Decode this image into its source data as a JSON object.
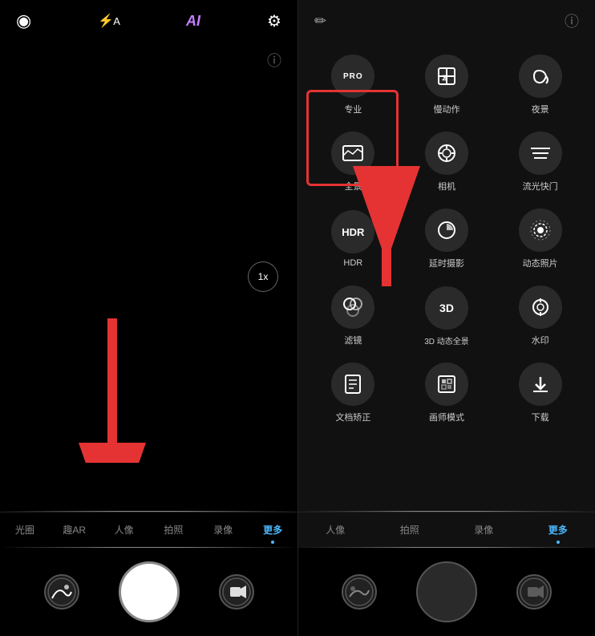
{
  "left": {
    "top_icons": [
      {
        "name": "lens-icon",
        "symbol": "◉",
        "color": "#fff"
      },
      {
        "name": "flash-icon",
        "symbol": "⚡A",
        "color": "#fff"
      },
      {
        "name": "ai-icon",
        "symbol": "AI",
        "color": "#c47fff"
      },
      {
        "name": "settings-icon",
        "symbol": "⚙",
        "color": "#fff"
      }
    ],
    "zoom": "1x",
    "bottom_nav": [
      {
        "label": "光圈",
        "active": false
      },
      {
        "label": "趣AR",
        "active": false
      },
      {
        "label": "人像",
        "active": false
      },
      {
        "label": "拍照",
        "active": false
      },
      {
        "label": "录像",
        "active": false
      },
      {
        "label": "更多",
        "active": true
      }
    ],
    "arrow_label": "arrow pointing to 更多"
  },
  "right": {
    "top_icons": [
      {
        "name": "pencil-icon",
        "symbol": "✏"
      },
      {
        "name": "info-icon",
        "symbol": "ⓘ"
      }
    ],
    "modes": [
      {
        "id": "pro",
        "icon_type": "text",
        "icon_text": "PRO",
        "label": "专业",
        "highlighted": true
      },
      {
        "id": "slow",
        "icon_type": "svg",
        "icon_text": "⧖",
        "label": "慢动作"
      },
      {
        "id": "night",
        "icon_type": "svg",
        "icon_text": "☽",
        "label": "夜景"
      },
      {
        "id": "panorama",
        "icon_type": "svg",
        "icon_text": "⊠",
        "label": "全景"
      },
      {
        "id": "camera2",
        "icon_type": "svg",
        "icon_text": "◑",
        "label": "相机"
      },
      {
        "id": "flow",
        "icon_type": "svg",
        "icon_text": "≡",
        "label": "流光快门"
      },
      {
        "id": "hdr",
        "icon_type": "text",
        "icon_text": "HDR",
        "label": "HDR"
      },
      {
        "id": "timelapse",
        "icon_type": "svg",
        "icon_text": "◔",
        "label": "延时摄影"
      },
      {
        "id": "dynamic",
        "icon_type": "svg",
        "icon_text": "✿",
        "label": "动态照片"
      },
      {
        "id": "filter",
        "icon_type": "svg",
        "icon_text": "⊛",
        "label": "滤镜"
      },
      {
        "id": "3d",
        "icon_type": "text",
        "icon_text": "3D",
        "label": "3D 动态全景"
      },
      {
        "id": "watermark",
        "icon_type": "svg",
        "icon_text": "◕",
        "label": "水印"
      },
      {
        "id": "doc",
        "icon_type": "svg",
        "icon_text": "📄",
        "label": "文档矫正"
      },
      {
        "id": "paint",
        "icon_type": "svg",
        "icon_text": "🖼",
        "label": "画师模式"
      },
      {
        "id": "download",
        "icon_type": "svg",
        "icon_text": "↓",
        "label": "下载"
      }
    ],
    "bottom_nav": [
      {
        "label": "人像",
        "active": false
      },
      {
        "label": "拍照",
        "active": false
      },
      {
        "label": "录像",
        "active": false
      },
      {
        "label": "更多",
        "active": true
      }
    ],
    "arrow_label": "arrow pointing to PRO"
  }
}
